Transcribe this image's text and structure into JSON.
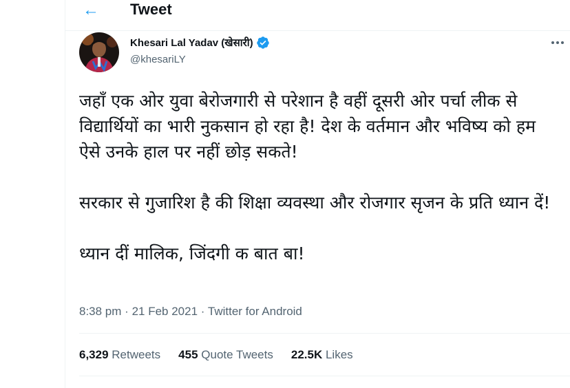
{
  "header": {
    "title": "Tweet",
    "back_icon": "arrow-left-icon"
  },
  "author": {
    "display_name": "Khesari Lal Yadav (खेसारी)",
    "handle": "@khesariLY",
    "verified": true,
    "avatar": "user-avatar"
  },
  "tweet": {
    "paragraphs": [
      "जहाँ एक ओर युवा बेरोजगारी से परेशान है वहीं दूसरी ओर पर्चा लीक से विद्यार्थियों का भारी नुकसान हो रहा है! देश के वर्तमान और भविष्य को हम ऐसे उनके हाल पर नहीं छोड़ सकते!",
      "सरकार से गुजारिश है की शिक्षा व्यवस्था और रोजगार सृजन के प्रति ध्यान दें!",
      "ध्यान दीं मालिक, जिंदगी क बात बा!"
    ],
    "time": "8:38 pm",
    "separator": "·",
    "date": "21 Feb 2021",
    "source": "Twitter for Android"
  },
  "stats": {
    "retweets": {
      "count": "6,329",
      "label": "Retweets"
    },
    "quotes": {
      "count": "455",
      "label": "Quote Tweets"
    },
    "likes": {
      "count": "22.5K",
      "label": "Likes"
    }
  },
  "colors": {
    "accent": "#1d9bf0",
    "text": "#0f1419",
    "muted": "#536471",
    "border": "#eff3f4"
  }
}
